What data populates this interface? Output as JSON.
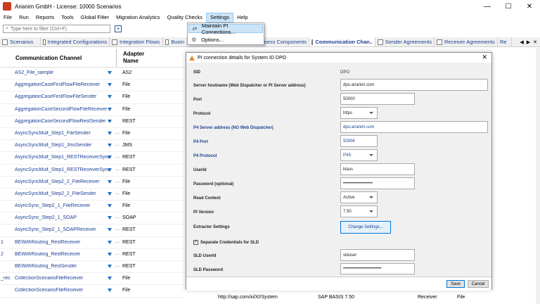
{
  "window": {
    "title": "Arianim GmbH - License: 10000 Scenarios",
    "controls": {
      "minimize": "—",
      "maximize": "☐",
      "close": "✕"
    }
  },
  "menu": [
    "File",
    "Run",
    "Reports",
    "Tools",
    "Global Filter",
    "Migration Analytics",
    "Quality Checks",
    "Settings",
    "Help"
  ],
  "settings_menu": {
    "items": [
      {
        "label": "Maintain PI Connections...",
        "icon": "connection-icon"
      },
      {
        "label": "Options...",
        "icon": "gear-icon"
      }
    ]
  },
  "filter": {
    "placeholder": "Type here to filter (Ctrl+F)"
  },
  "tabs": [
    {
      "label": "Scenarios"
    },
    {
      "label": "Integrated Configurations"
    },
    {
      "label": "Integration Flows"
    },
    {
      "label": "Busin"
    },
    {
      "label": "ness Components"
    },
    {
      "label": "Communication Chan.."
    },
    {
      "label": "Sender Agreements"
    },
    {
      "label": "Receiver Agreements"
    },
    {
      "label": "Re"
    }
  ],
  "grid": {
    "headers": {
      "channel": "Communication Channel",
      "adapter": "Adapter Name"
    },
    "rows": [
      {
        "pre": "",
        "channel": "AS2_File_sample",
        "dots": "",
        "adapter": "AS2"
      },
      {
        "pre": "",
        "channel": "AggregationCaseFirstFlowFileReceiver",
        "dots": "",
        "adapter": "File"
      },
      {
        "pre": "",
        "channel": "AggregationCaseFirstFlowFileSender",
        "dots": "",
        "adapter": "File"
      },
      {
        "pre": "",
        "channel": "AggregationCaseSecondFlowFileReceiver",
        "dots": "",
        "adapter": "File"
      },
      {
        "pre": "",
        "channel": "AggregationCaseSecondFlowRestSender",
        "dots": "",
        "adapter": "REST"
      },
      {
        "pre": "",
        "channel": "AsyncSyncMult_Step1_FileSender",
        "dots": "...",
        "adapter": "File"
      },
      {
        "pre": "",
        "channel": "AsyncSyncMult_Step1_JmsSender",
        "dots": "...",
        "adapter": "JMS"
      },
      {
        "pre": "",
        "channel": "AsyncSyncMult_Step1_RESTReceiverSync",
        "dots": "...",
        "adapter": "REST"
      },
      {
        "pre": "",
        "channel": "AsyncSyncMult_Step1_RESTReceiverSync",
        "dots": "...",
        "adapter": "REST"
      },
      {
        "pre": "",
        "channel": "AsyncSyncMult_Step2_2_FileReceiver",
        "dots": "...",
        "adapter": "File"
      },
      {
        "pre": "",
        "channel": "AsyncSyncMult_Step2_2_FileSender",
        "dots": "...",
        "adapter": "File"
      },
      {
        "pre": "",
        "channel": "AsyncSync_Step2_1_FileReceiver",
        "dots": "",
        "adapter": "File"
      },
      {
        "pre": "",
        "channel": "AsyncSync_Step2_1_SOAP",
        "dots": "...",
        "adapter": "SOAP"
      },
      {
        "pre": "",
        "channel": "AsyncSync_Step2_1_SOAPReceiver",
        "dots": "...",
        "adapter": "REST"
      },
      {
        "pre": "1",
        "channel": "BEWithRouting_RestReceiver",
        "dots": "...",
        "adapter": "REST"
      },
      {
        "pre": "2",
        "channel": "BEWithRouting_RestReceiver",
        "dots": "...",
        "adapter": "REST"
      },
      {
        "pre": "",
        "channel": "BEWithRouting_RestSender",
        "dots": "...",
        "adapter": "REST"
      },
      {
        "pre": "_rec",
        "channel": "CollectionScenarioFileReceiver",
        "dots": "",
        "adapter": "File"
      },
      {
        "pre": "",
        "channel": "CollectionScenarioFileReceiver",
        "dots": "",
        "adapter": "File"
      }
    ]
  },
  "bottom_row": {
    "ns": "http://sap.com/xi/XI/System",
    "swc": "SAP BASIS 7.50",
    "dir": "Receiver",
    "adapter": "File"
  },
  "dialog": {
    "title": "PI connection details for System ID DPO",
    "close": "✕",
    "sid_label": "SID",
    "sid_value": "DPO",
    "host_label": "Server hostname (Web Dispatcher or PI Server address)",
    "host_value": "dpo.arianim.com",
    "port_label": "Port",
    "port_value": "50000",
    "protocol_label": "Protocol",
    "protocol_value": "https",
    "p4server_label": "P4 Server address (NO Web Dispatcher)",
    "p4server_value": "dpo.arianim.com",
    "p4port_label": "P4 Port",
    "p4port_value": "50006",
    "p4protocol_label": "P4 Protocol",
    "p4protocol_value": "P4S",
    "userid_label": "UserId",
    "userid_value": "klaus",
    "password_label": "Password (optional)",
    "password_value": "••••••••••••••••••••",
    "readctx_label": "Read Context",
    "readctx_value": "Active",
    "piversion_label": "PI Version",
    "piversion_value": "7.50",
    "extractor_label": "Extractor Settings",
    "change_button": "Change Settings...",
    "separate_label": "Separate Credentials for SLD",
    "separate_checked": "✓",
    "sld_user_label": "SLD UserId",
    "sld_user_value": "slduser",
    "sld_pass_label": "SLD Password",
    "sld_pass_value": "••••••••••••••••••••••••••",
    "save": "Save",
    "cancel": "Cancel"
  }
}
